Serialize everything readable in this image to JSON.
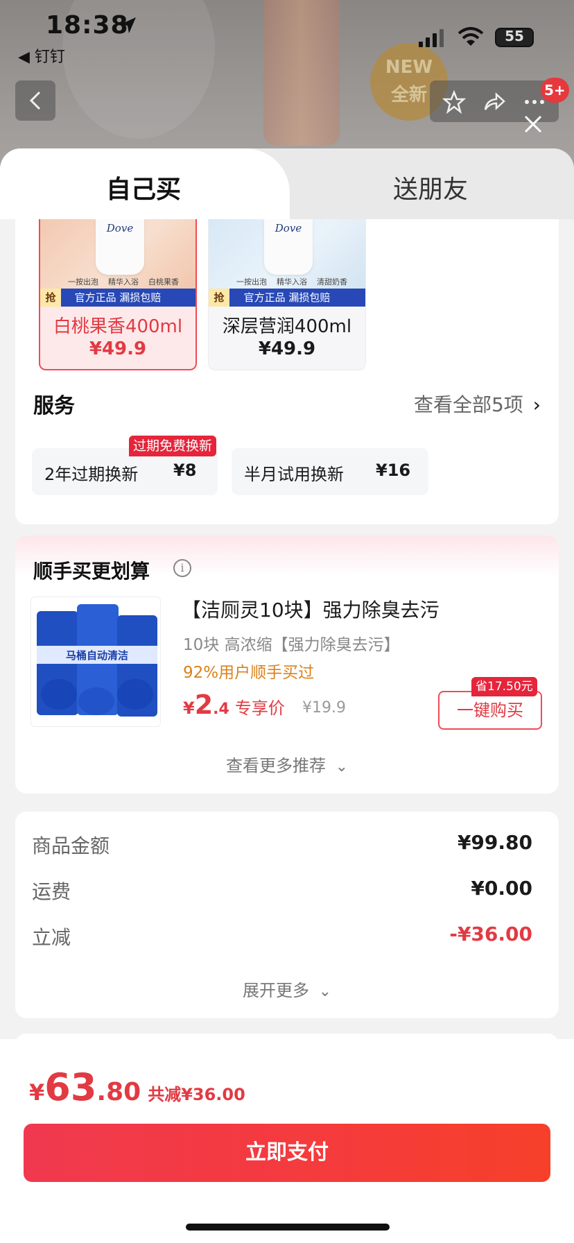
{
  "status_bar": {
    "time": "18:38",
    "back_app": "◀ 钉钉",
    "battery": "55"
  },
  "background": {
    "badge_line1": "NEW",
    "badge_line2": "全新",
    "notification_count": "5+"
  },
  "tabs": {
    "self": "自己买",
    "gift": "送朋友"
  },
  "variants": [
    {
      "brand": "Dove",
      "features": [
        "一按出泡",
        "精华入浴",
        "白桃果香"
      ],
      "strip_tag": "抢",
      "strip_text": "官方正品 漏损包赔",
      "name": "白桃果香400ml",
      "price": "¥49.9",
      "selected": true
    },
    {
      "brand": "Dove",
      "features": [
        "一按出泡",
        "精华入浴",
        "清甜奶香"
      ],
      "strip_tag": "抢",
      "strip_text": "官方正品 漏损包赔",
      "name": "深层营润400ml",
      "price": "¥49.9",
      "selected": false
    }
  ],
  "services": {
    "title": "服务",
    "view_all": "查看全部5项",
    "items": [
      {
        "label": "2年过期换新",
        "price": "¥8",
        "tag": "过期免费换新"
      },
      {
        "label": "半月试用换新",
        "price": "¥16"
      }
    ]
  },
  "recommend": {
    "title": "顺手买更划算",
    "product_name": "【洁厕灵10块】强力除臭去污",
    "product_subtitle": "10块 高浓缩【强力除臭去污】",
    "popularity": "92%用户顺手买过",
    "price_currency": "¥",
    "price_int": "2",
    "price_dec": ".4",
    "price_label": "专享价",
    "original_price": "¥19.9",
    "save_tag": "省17.50元",
    "buy_label": "一键购买",
    "more_label": "查看更多推荐",
    "image_text": "马桶自动清洁"
  },
  "summary": {
    "rows": [
      {
        "label": "商品金额",
        "value": "¥99.80"
      },
      {
        "label": "运费",
        "value": "¥0.00"
      },
      {
        "label": "立减",
        "value": "-¥36.00"
      }
    ],
    "expand_label": "展开更多"
  },
  "footer": {
    "currency": "¥",
    "total_int": "63",
    "total_dec": ".80",
    "discount": "共减¥36.00",
    "pay_label": "立即支付"
  },
  "colors": {
    "accent_red": "#e23a43",
    "pay_button": "#f0394f",
    "popularity_orange": "#d9821c"
  }
}
